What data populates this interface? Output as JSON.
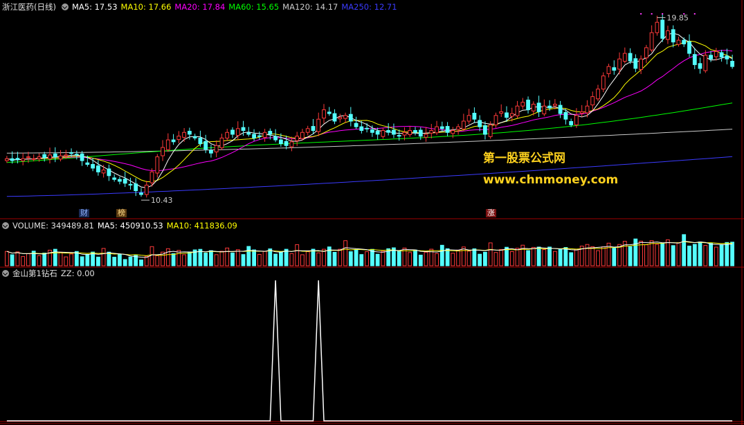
{
  "main": {
    "stock_label": "浙江医药(日线)",
    "ma": [
      {
        "label": "MA5: 17.53",
        "color": "#ffffff"
      },
      {
        "label": "MA10: 17.66",
        "color": "#ffff00"
      },
      {
        "label": "MA20: 17.84",
        "color": "#ff00ff"
      },
      {
        "label": "MA60: 15.65",
        "color": "#00ff00"
      },
      {
        "label": "MA120: 14.17",
        "color": "#cccccc"
      },
      {
        "label": "MA250: 12.71",
        "color": "#3b3bff"
      }
    ],
    "high_label": "19.85",
    "low_label": "10.43",
    "tags": [
      {
        "text": "财",
        "color": "#8fb4ff",
        "bg": "#1a2a55"
      },
      {
        "text": "榜",
        "color": "#ffdd88",
        "bg": "#5a3a10"
      },
      {
        "text": "涨",
        "color": "#ffffff",
        "bg": "#7a1010"
      }
    ]
  },
  "volume": {
    "label": "VOLUME: 349489.81",
    "ma5": "MA5: 450910.53",
    "ma10": "MA10: 411836.09",
    "ma5_color": "#ffffff",
    "ma10_color": "#ffff00"
  },
  "indicator": {
    "label": "金山第1钻石",
    "zz": "ZZ: 0.00"
  },
  "watermark": {
    "line1": "第一股票公式网",
    "line2": "www.chnmoney.com"
  },
  "chart_data": {
    "type": "candlestick",
    "ylim": [
      10.0,
      20.3
    ],
    "closes": [
      12.6,
      12.5,
      12.55,
      12.6,
      12.7,
      12.6,
      12.7,
      12.65,
      12.8,
      12.7,
      12.75,
      12.8,
      12.9,
      12.8,
      12.5,
      12.3,
      12.1,
      11.9,
      12.0,
      11.7,
      11.5,
      11.4,
      11.3,
      11.2,
      10.9,
      10.7,
      11.2,
      11.9,
      12.7,
      13.2,
      13.6,
      13.5,
      13.8,
      14.0,
      13.9,
      13.7,
      13.4,
      13.1,
      12.9,
      13.3,
      13.7,
      14.0,
      13.9,
      14.2,
      14.1,
      13.9,
      13.7,
      13.8,
      14.0,
      13.9,
      13.6,
      13.4,
      13.3,
      13.5,
      13.8,
      14.0,
      14.2,
      14.1,
      14.7,
      15.2,
      15.0,
      14.6,
      14.8,
      14.9,
      14.6,
      14.3,
      14.1,
      14.2,
      14.0,
      13.9,
      14.1,
      14.0,
      13.9,
      13.8,
      14.0,
      14.1,
      14.0,
      13.8,
      13.9,
      14.1,
      14.3,
      14.2,
      14.0,
      14.1,
      14.3,
      14.6,
      14.9,
      14.7,
      14.3,
      13.9,
      14.4,
      14.9,
      15.1,
      14.8,
      15.0,
      15.4,
      15.6,
      15.2,
      15.5,
      15.1,
      15.4,
      15.3,
      15.5,
      15.0,
      14.7,
      14.4,
      14.9,
      15.1,
      15.4,
      15.9,
      16.3,
      17.0,
      17.5,
      17.3,
      17.9,
      18.2,
      17.8,
      17.4,
      17.9,
      18.5,
      19.3,
      19.85,
      19.0,
      19.4,
      18.8,
      18.9,
      18.7,
      18.2,
      17.6,
      17.4,
      18.1,
      17.9,
      18.3,
      18.0,
      17.9,
      17.5
    ],
    "ma5_last": 17.53,
    "ma10_last": 17.66,
    "ma20_last": 17.84,
    "ma60_last": 15.65,
    "ma120_last": 14.17,
    "ma250_last": 12.71,
    "volume_ylim": [
      0,
      1100000
    ],
    "zz_peaks": [
      50,
      58
    ]
  }
}
